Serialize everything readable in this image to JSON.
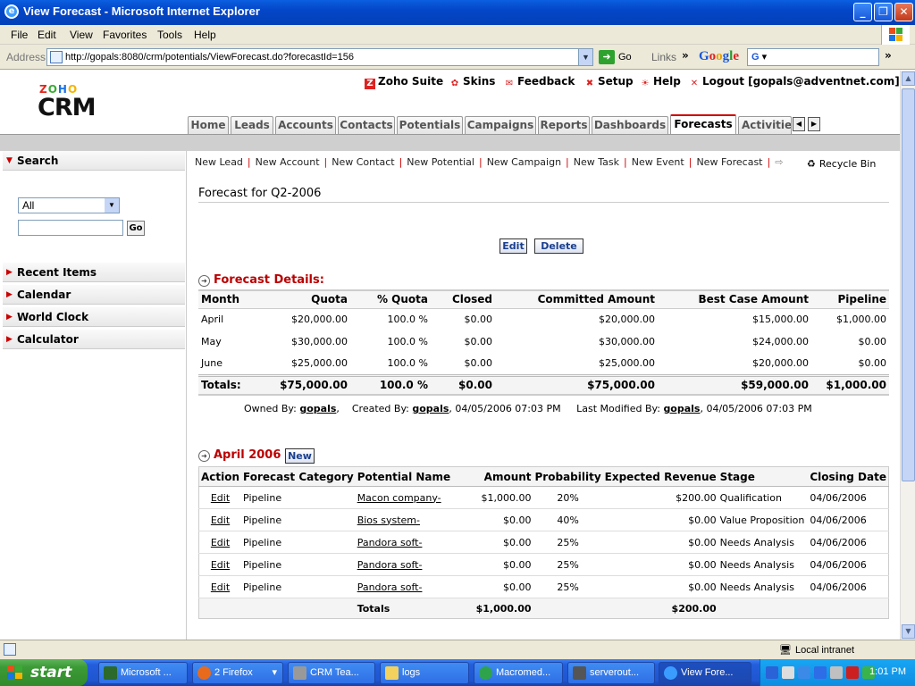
{
  "window": {
    "title": "View Forecast - Microsoft Internet Explorer"
  },
  "menu": [
    "File",
    "Edit",
    "View",
    "Favorites",
    "Tools",
    "Help"
  ],
  "address": {
    "label": "Address",
    "url": "http://gopals:8080/crm/potentials/ViewForecast.do?forecastId=156",
    "go_label": "Go",
    "links_label": "Links",
    "google_label": "Google",
    "google_box": "G"
  },
  "header": {
    "logo_zoho": [
      "Z",
      "O",
      "H",
      "O"
    ],
    "logo_crm": "CRM",
    "links": {
      "zoho_suite": "Zoho Suite",
      "skins": "Skins",
      "feedback": "Feedback",
      "setup": "Setup",
      "help": "Help",
      "logout": "Logout [gopals@adventnet.com]"
    }
  },
  "tabs": {
    "home": "Home",
    "leads": "Leads",
    "accounts": "Accounts",
    "contacts": "Contacts",
    "potentials": "Potentials",
    "campaigns": "Campaigns",
    "reports": "Reports",
    "dashboards": "Dashboards",
    "forecasts": "Forecasts",
    "activities": "Activitie"
  },
  "sidebar": {
    "search": "Search",
    "filter_value": "All",
    "go_label": "Go",
    "recent_items": "Recent Items",
    "calendar": "Calendar",
    "world_clock": "World Clock",
    "calculator": "Calculator"
  },
  "quicklinks": {
    "new_lead": "New Lead",
    "new_account": "New Account",
    "new_contact": "New Contact",
    "new_potential": "New Potential",
    "new_campaign": "New Campaign",
    "new_task": "New Task",
    "new_event": "New Event",
    "new_forecast": "New Forecast",
    "recycle_bin": "Recycle Bin"
  },
  "page": {
    "title": "Forecast for Q2-2006",
    "edit_label": "Edit",
    "delete_label": "Delete",
    "details_heading": "Forecast Details:",
    "forecast_table": {
      "headers": [
        "Month",
        "Quota",
        "% Quota",
        "Closed",
        "Committed Amount",
        "Best Case Amount",
        "Pipeline"
      ],
      "rows": [
        [
          "April",
          "$20,000.00",
          "100.0 %",
          "$0.00",
          "$20,000.00",
          "$15,000.00",
          "$1,000.00"
        ],
        [
          "May",
          "$30,000.00",
          "100.0 %",
          "$0.00",
          "$30,000.00",
          "$24,000.00",
          "$0.00"
        ],
        [
          "June",
          "$25,000.00",
          "100.0 %",
          "$0.00",
          "$25,000.00",
          "$20,000.00",
          "$0.00"
        ]
      ],
      "totals": [
        "Totals:",
        "$75,000.00",
        "100.0 %",
        "$0.00",
        "$75,000.00",
        "$59,000.00",
        "$1,000.00"
      ]
    },
    "ownership": {
      "owned_label": "Owned By:",
      "owner": "gopals",
      "created_label": "Created By:",
      "creator": "gopals",
      "created_at": ", 04/05/2006 07:03 PM",
      "modified_label": "Last Modified By:",
      "modifier": "gopals",
      "modified_at": ", 04/05/2006 07:03 PM"
    },
    "april_heading": "April 2006",
    "new_label": "New",
    "detail_table": {
      "headers": [
        "Action",
        "Forecast Category",
        "Potential Name",
        "Amount",
        "Probability",
        "Expected Revenue",
        "Stage",
        "Closing Date"
      ],
      "rows": [
        [
          "Edit",
          "Pipeline",
          "Macon company-",
          "$1,000.00",
          "20%",
          "$200.00",
          "Qualification",
          "04/06/2006"
        ],
        [
          "Edit",
          "Pipeline",
          "Bios system-",
          "$0.00",
          "40%",
          "$0.00",
          "Value Proposition",
          "04/06/2006"
        ],
        [
          "Edit",
          "Pipeline",
          "Pandora soft-",
          "$0.00",
          "25%",
          "$0.00",
          "Needs Analysis",
          "04/06/2006"
        ],
        [
          "Edit",
          "Pipeline",
          "Pandora soft-",
          "$0.00",
          "25%",
          "$0.00",
          "Needs Analysis",
          "04/06/2006"
        ],
        [
          "Edit",
          "Pipeline",
          "Pandora soft-",
          "$0.00",
          "25%",
          "$0.00",
          "Needs Analysis",
          "04/06/2006"
        ]
      ],
      "totals": {
        "label": "Totals",
        "amount": "$1,000.00",
        "expected": "$200.00"
      }
    }
  },
  "status": {
    "zone": "Local intranet"
  },
  "taskbar": {
    "start": "start",
    "tasks": [
      "Microsoft ...",
      "2 Firefox",
      "CRM Tea...",
      "logs",
      "Macromed...",
      "serverout...",
      "View Fore..."
    ],
    "clock": "1:01 PM"
  },
  "colors": {
    "accent_red": "#bb0000",
    "title_blue": "#0446c8",
    "taskbar_blue": "#245edb",
    "start_green": "#3c9b36"
  }
}
